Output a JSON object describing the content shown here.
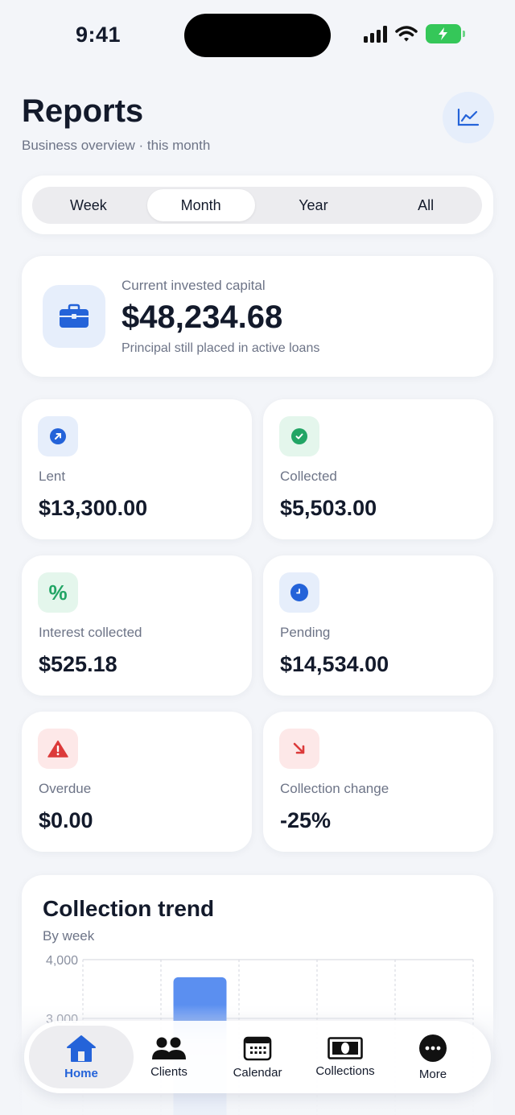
{
  "status": {
    "time": "9:41"
  },
  "header": {
    "title": "Reports",
    "subtitle": "Business overview · this month"
  },
  "period": {
    "options": [
      "Week",
      "Month",
      "Year",
      "All"
    ],
    "selected": "Month"
  },
  "capital": {
    "label": "Current invested capital",
    "value": "$48,234.68",
    "note": "Principal still placed in active loans"
  },
  "stats": [
    {
      "label": "Lent",
      "value": "$13,300.00",
      "icon": "arrow-up-right-icon"
    },
    {
      "label": "Collected",
      "value": "$5,503.00",
      "icon": "check-circle-icon"
    },
    {
      "label": "Interest collected",
      "value": "$525.18",
      "icon": "percent-icon"
    },
    {
      "label": "Pending",
      "value": "$14,534.00",
      "icon": "clock-icon"
    },
    {
      "label": "Overdue",
      "value": "$0.00",
      "icon": "warning-icon"
    },
    {
      "label": "Collection change",
      "value": "-25%",
      "icon": "arrow-down-right-icon"
    }
  ],
  "colors": {
    "accent": "#2463d9",
    "green": "#22a565",
    "red": "#dc3a3a",
    "bar": "#5b8ff0"
  },
  "trend": {
    "title": "Collection trend",
    "subtitle": "By week"
  },
  "chart_data": {
    "type": "bar",
    "title": "Collection trend",
    "subtitle": "By week",
    "y_tick_labels": [
      "4,000",
      "3,000"
    ],
    "ylim_visible": [
      3000,
      4000
    ],
    "values_visible": [
      null,
      3700,
      null,
      null,
      null
    ],
    "grid": true
  },
  "tabbar": {
    "items": [
      {
        "label": "Home",
        "icon": "home-icon",
        "active": true
      },
      {
        "label": "Clients",
        "icon": "people-icon",
        "active": false
      },
      {
        "label": "Calendar",
        "icon": "calendar-icon",
        "active": false
      },
      {
        "label": "Collections",
        "icon": "banknote-icon",
        "active": false
      },
      {
        "label": "More",
        "icon": "more-icon",
        "active": false
      }
    ]
  }
}
